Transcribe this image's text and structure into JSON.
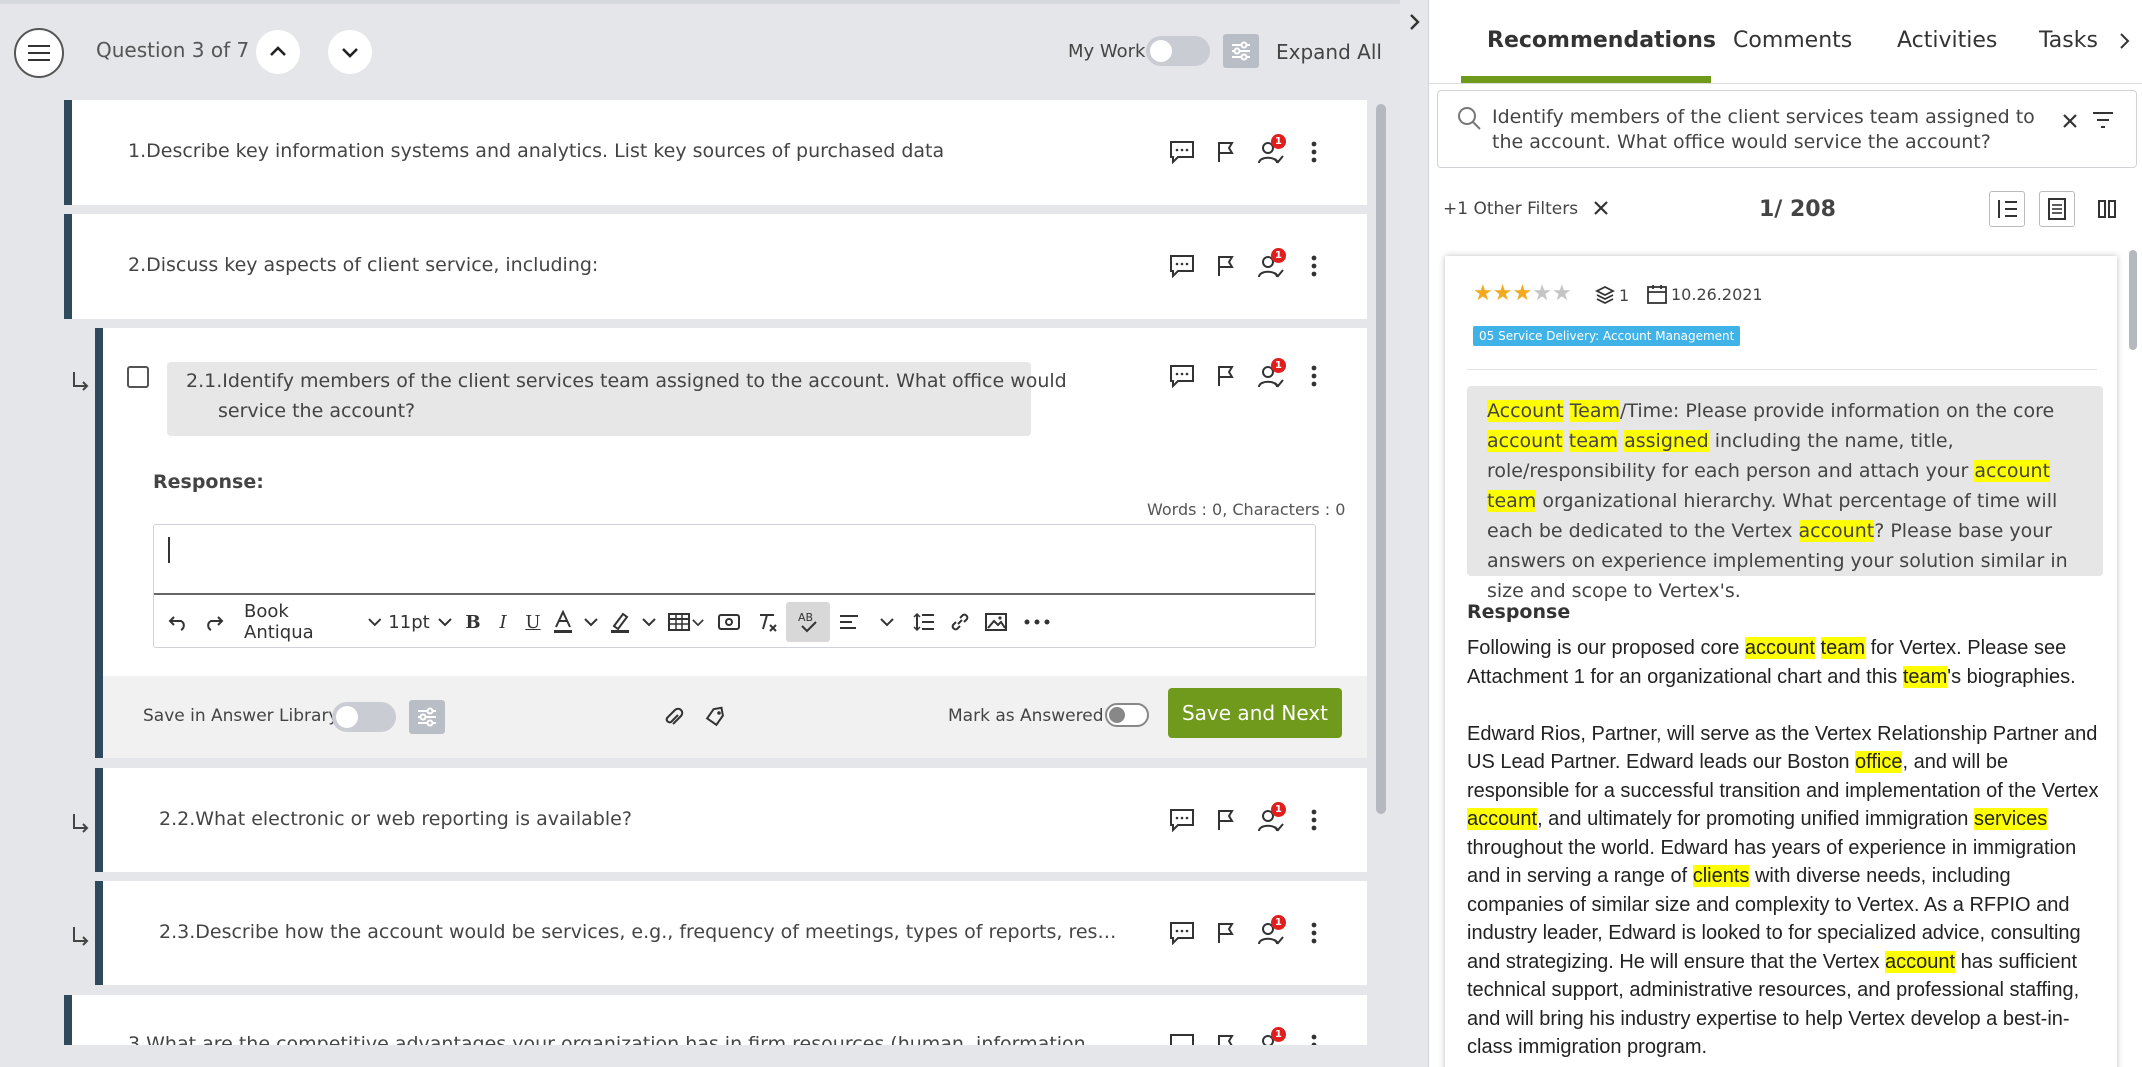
{
  "header": {
    "question_count": "Question 3 of 7",
    "my_work_label": "My Work",
    "expand_all_label": "Expand All"
  },
  "questions": [
    {
      "text": "1.Describe key information systems and analytics. List key sources of purchased data",
      "badge": "1"
    },
    {
      "text": "2.Discuss key aspects of client service, including:",
      "badge": "1"
    },
    {
      "text": "2.1.Identify members of the client services team assigned to the account. What office would",
      "text2": "service the account?",
      "badge": "1"
    },
    {
      "text": "2.2.What electronic or web reporting is available?",
      "badge": "1"
    },
    {
      "text": "2.3.Describe how the account would be services, e.g., frequency of meetings, types of reports, res…",
      "badge": "1"
    },
    {
      "text": "3.What are the competitive advantages your organization has in firm resources (human, information",
      "badge": "1"
    }
  ],
  "editor": {
    "response_label": "Response:",
    "word_count": "Words : 0, Characters : 0",
    "font_name": "Book Antiqua",
    "font_size": "11pt",
    "save_library_label": "Save in Answer Library",
    "mark_answered_label": "Mark as Answered",
    "save_next_label": "Save and Next"
  },
  "panel": {
    "tabs": [
      "Recommendations",
      "Comments",
      "Activities",
      "Tasks"
    ],
    "search_text": "Identify members of the client services team assigned to the account. What office would service the account?",
    "other_filters": "+1 Other Filters",
    "pager": "1/ 208",
    "card": {
      "rating": 3,
      "rating_max": 5,
      "layers_count": "1",
      "date": "10.26.2021",
      "tag": "05 Service Delivery: Account Management",
      "response_heading": "Response"
    }
  },
  "colors": {
    "accent_green": "#6f9a1b",
    "card_border": "#2e4a5c",
    "tag_blue": "#3fb3e8",
    "highlight": "#ffff00",
    "badge_red": "#e01e1e"
  }
}
